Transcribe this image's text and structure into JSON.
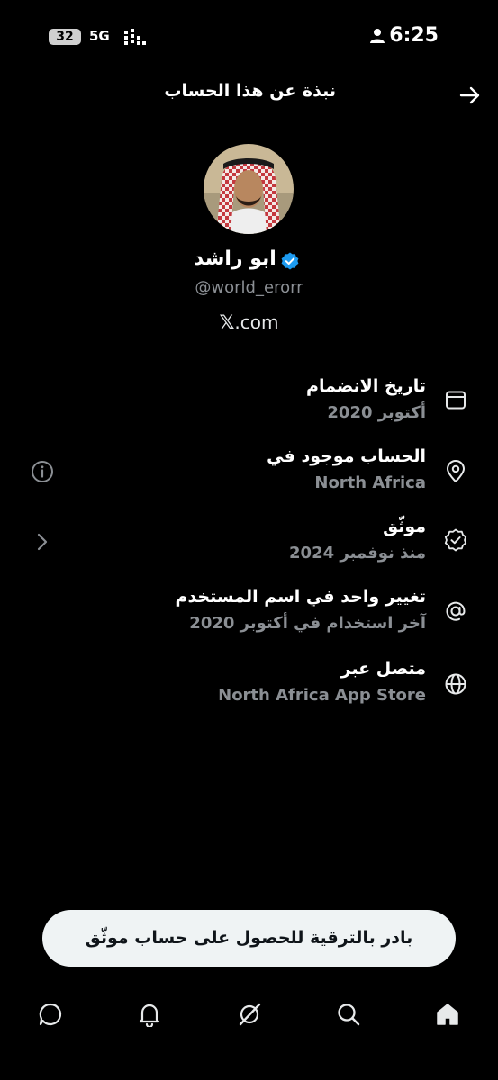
{
  "status_bar": {
    "battery": "32",
    "network": "5G",
    "time": "6:25"
  },
  "header": {
    "title": "نبذة عن هذا الحساب"
  },
  "profile": {
    "display_name": "ابو راشد",
    "handle": "@world_erorr",
    "site_suffix": ".com",
    "site_x": "𝕏"
  },
  "rows": [
    {
      "title": "تاريخ الانضمام",
      "subtitle": "أكتوبر 2020",
      "icon": "calendar-icon"
    },
    {
      "title": "الحساب موجود في",
      "subtitle": "North Africa",
      "icon": "location-pin-icon"
    },
    {
      "title": "موثّق",
      "subtitle": "منذ نوفمبر 2024",
      "icon": "verified-badge-icon"
    },
    {
      "title": "تغيير واحد في اسم المستخدم",
      "subtitle": "آخر استخدام في أكتوبر 2020",
      "icon": "at-sign-icon"
    },
    {
      "title": "متصل عبر",
      "subtitle": "North Africa App Store",
      "icon": "globe-icon"
    }
  ],
  "upgrade_button": {
    "label": "بادر بالترقية للحصول على حساب موثّق"
  },
  "colors": {
    "background": "#000000",
    "text_primary": "#e7e9ea",
    "text_secondary": "#8b8f94",
    "verified_blue": "#1d9bf0",
    "button_bg": "#eff3f4"
  }
}
